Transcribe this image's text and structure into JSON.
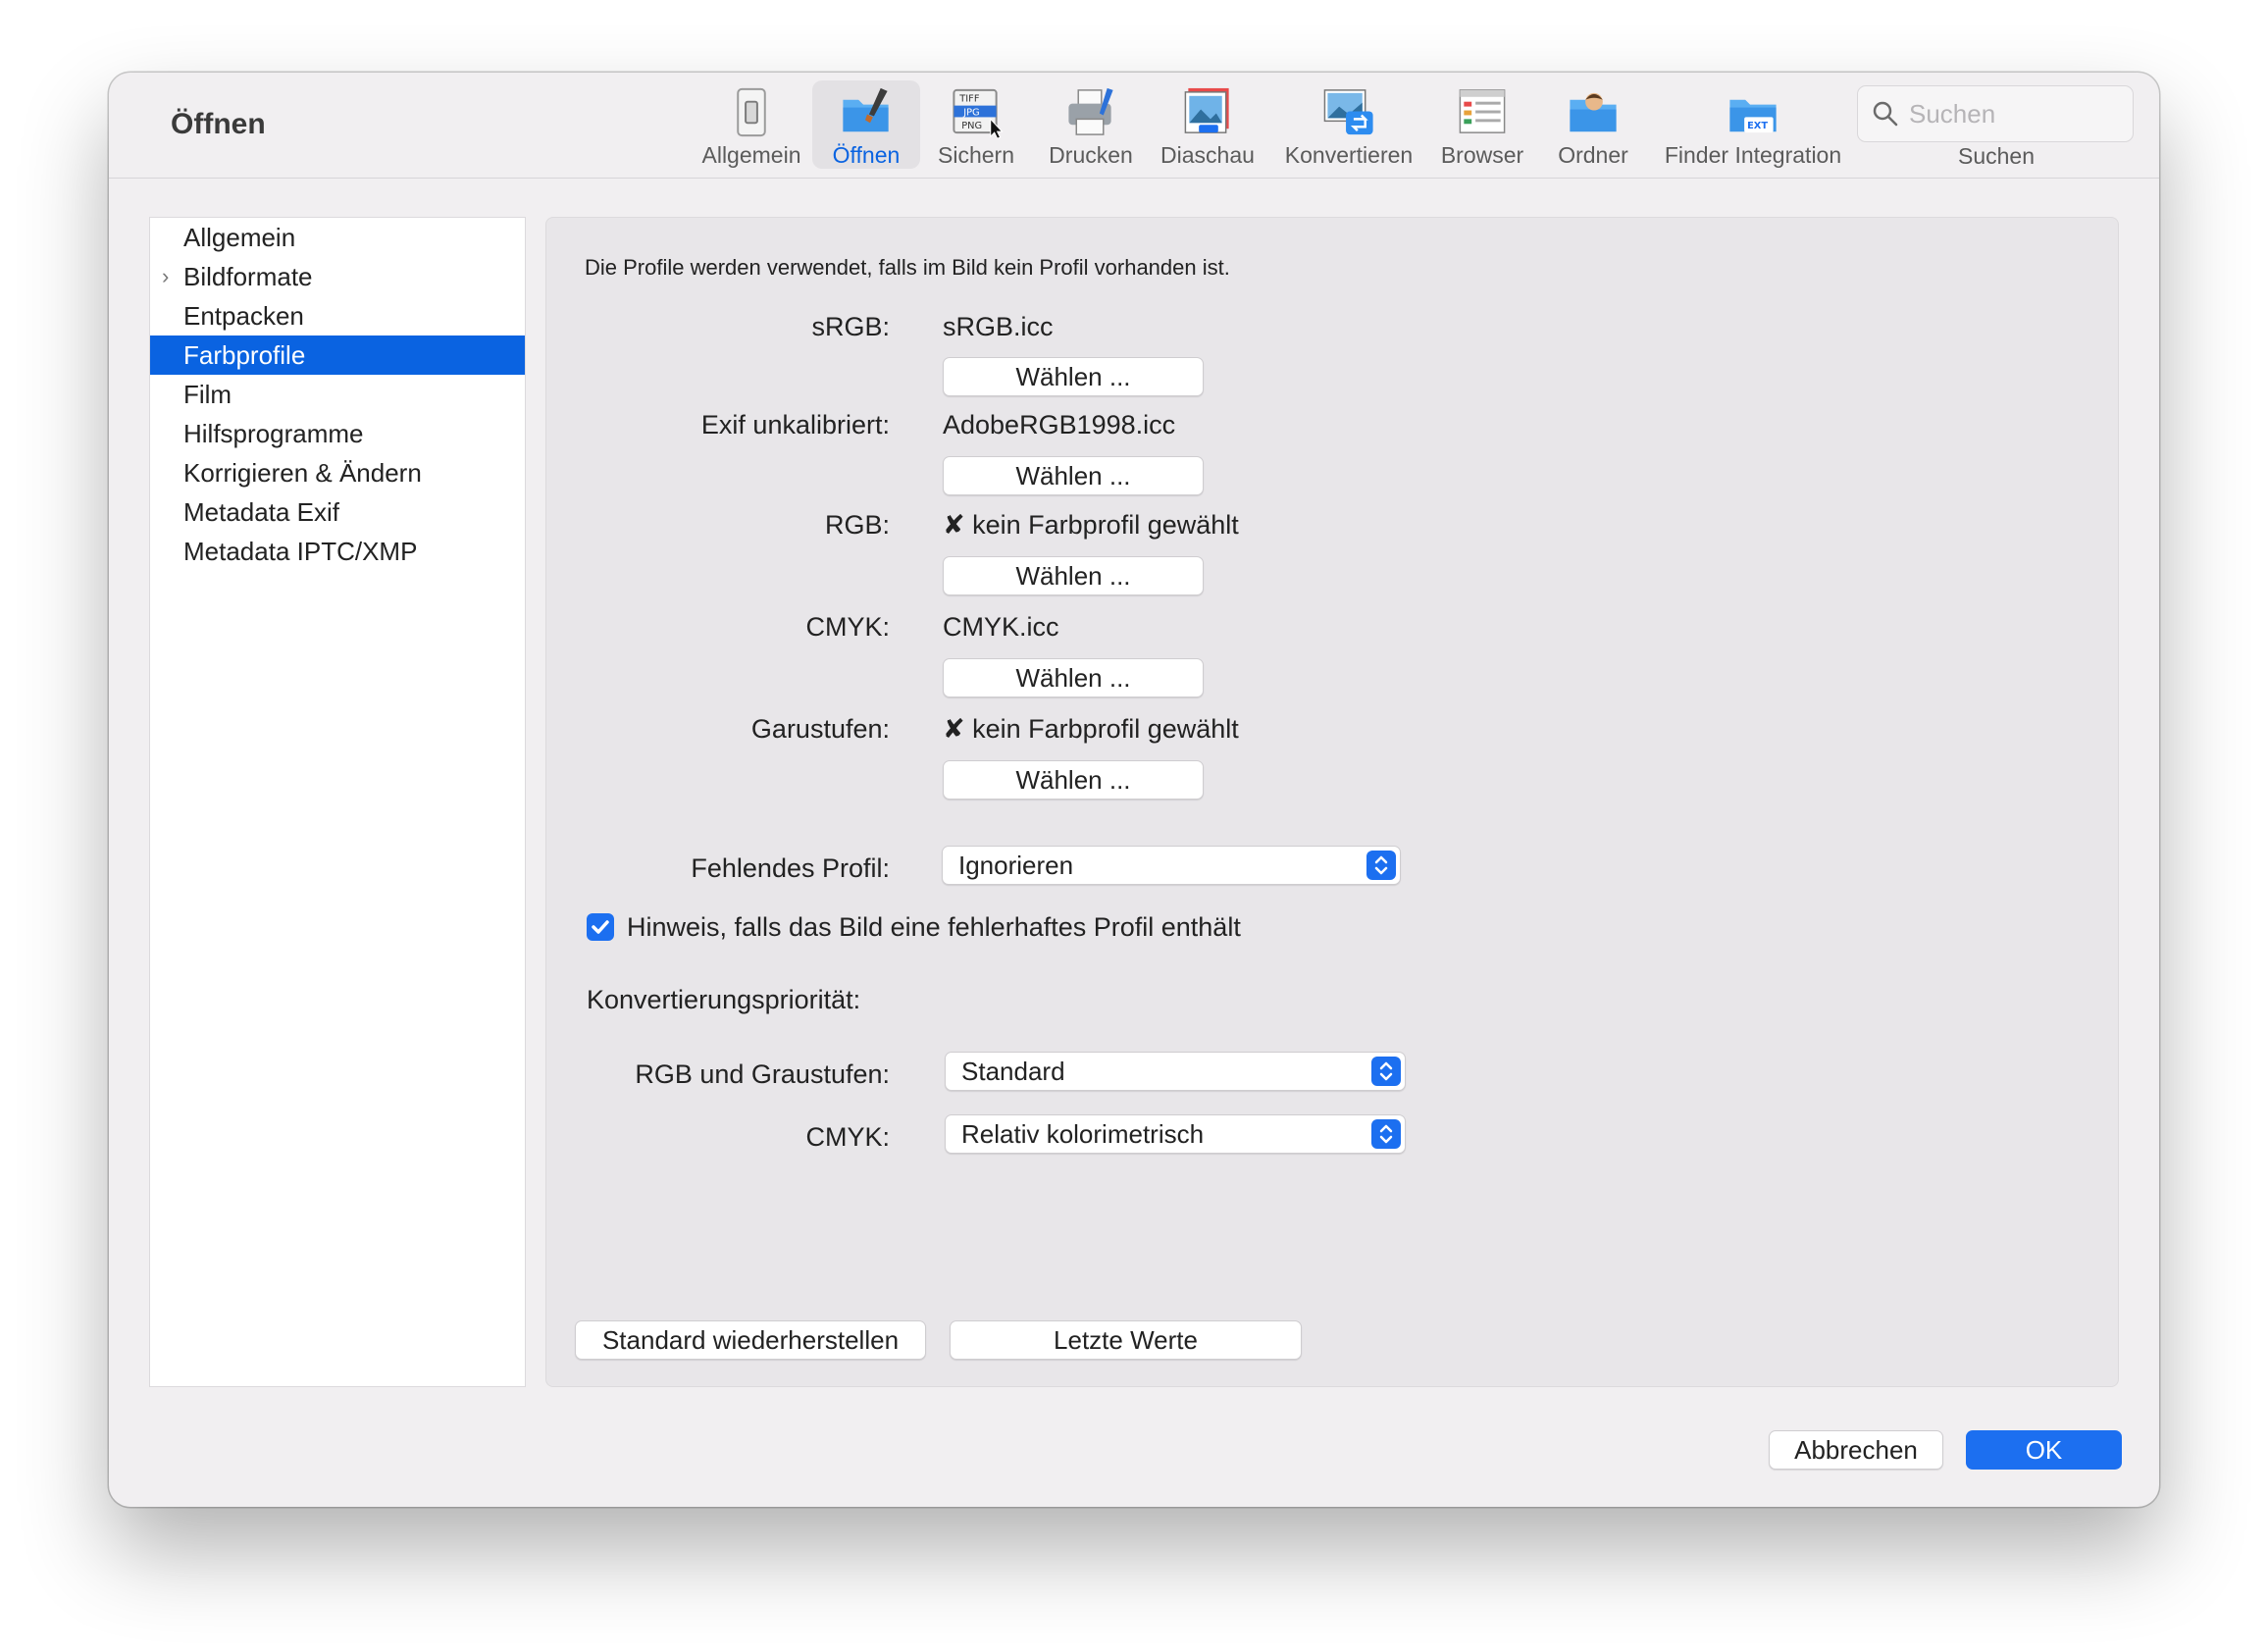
{
  "window": {
    "title": "Öffnen"
  },
  "toolbar": {
    "items": [
      {
        "label": "Allgemein",
        "icon": "general-switch-icon"
      },
      {
        "label": "Öffnen",
        "icon": "open-folder-icon",
        "active": true
      },
      {
        "label": "Sichern",
        "icon": "save-formats-icon"
      },
      {
        "label": "Drucken",
        "icon": "printer-icon"
      },
      {
        "label": "Diaschau",
        "icon": "slideshow-icon"
      },
      {
        "label": "Konvertieren",
        "icon": "convert-icon"
      },
      {
        "label": "Browser",
        "icon": "browser-icon"
      },
      {
        "label": "Ordner",
        "icon": "folder-person-icon"
      },
      {
        "label": "Finder Integration",
        "icon": "finder-extension-icon"
      }
    ],
    "search": {
      "placeholder": "Suchen",
      "label": "Suchen"
    }
  },
  "sidebar": {
    "items": [
      {
        "label": "Allgemein"
      },
      {
        "label": "Bildformate",
        "expandable": true
      },
      {
        "label": "Entpacken"
      },
      {
        "label": "Farbprofile",
        "selected": true
      },
      {
        "label": "Film"
      },
      {
        "label": "Hilfsprogramme"
      },
      {
        "label": "Korrigieren & Ändern"
      },
      {
        "label": "Metadata Exif"
      },
      {
        "label": "Metadata IPTC/XMP"
      }
    ]
  },
  "main": {
    "intro": "Die Profile werden verwendet, falls im Bild kein Profil vorhanden ist.",
    "profiles": [
      {
        "label": "sRGB:",
        "value": "sRGB.icc",
        "button": "Wählen ..."
      },
      {
        "label": "Exif unkalibriert:",
        "value": "AdobeRGB1998.icc",
        "button": "Wählen ..."
      },
      {
        "label": "RGB:",
        "value": "✘ kein Farbprofil gewählt",
        "button": "Wählen ..."
      },
      {
        "label": "CMYK:",
        "value": "CMYK.icc",
        "button": "Wählen ..."
      },
      {
        "label": "Garustufen:",
        "value": "✘ kein Farbprofil gewählt",
        "button": "Wählen ..."
      }
    ],
    "missing_profile": {
      "label": "Fehlendes Profil:",
      "value": "Ignorieren"
    },
    "warning_checkbox": {
      "label": "Hinweis, falls das Bild eine fehlerhaftes Profil enthält",
      "checked": true
    },
    "conversion_heading": "Konvertierungspriorität:",
    "rgb_gray": {
      "label": "RGB und Graustufen:",
      "value": "Standard"
    },
    "cmyk": {
      "label": "CMYK:",
      "value": "Relativ kolorimetrisch"
    },
    "restore_button": "Standard wiederherstellen",
    "last_values_button": "Letzte Werte"
  },
  "footer": {
    "cancel": "Abbrechen",
    "ok": "OK"
  },
  "colors": {
    "accent": "#1c6ff0",
    "selection": "#0a63e1",
    "window_bg": "#f1eff1"
  }
}
